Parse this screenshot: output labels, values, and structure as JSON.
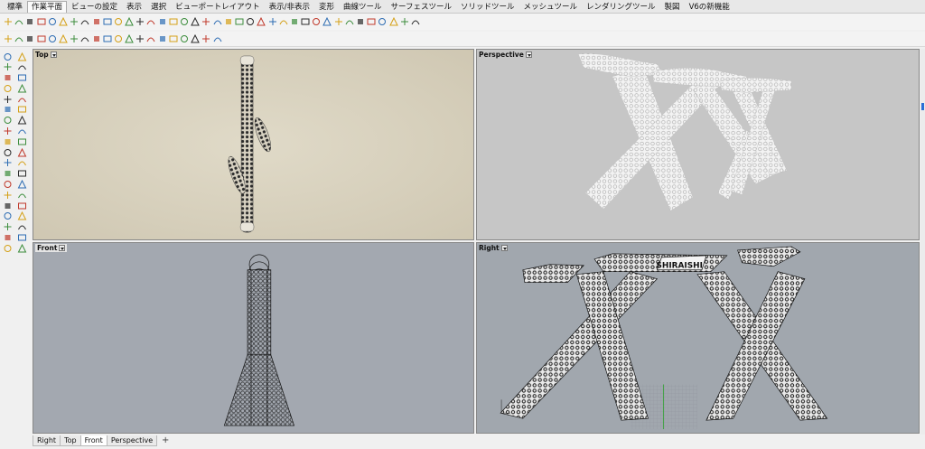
{
  "menu_tabs": [
    {
      "label": "標準",
      "active": false
    },
    {
      "label": "作業平面",
      "active": true
    },
    {
      "label": "ビューの設定",
      "active": false
    },
    {
      "label": "表示",
      "active": false
    },
    {
      "label": "選択",
      "active": false
    },
    {
      "label": "ビューポートレイアウト",
      "active": false
    },
    {
      "label": "表示/非表示",
      "active": false
    },
    {
      "label": "変形",
      "active": false
    },
    {
      "label": "曲線ツール",
      "active": false
    },
    {
      "label": "サーフェスツール",
      "active": false
    },
    {
      "label": "ソリッドツール",
      "active": false
    },
    {
      "label": "メッシュツール",
      "active": false
    },
    {
      "label": "レンダリングツール",
      "active": false
    },
    {
      "label": "製図",
      "active": false
    },
    {
      "label": "V6の新機能",
      "active": false
    }
  ],
  "toolbar_row1_icons": [
    "cplane-icon",
    "cplane-elevation-icon",
    "cplane-world-icon",
    "cplane-object-icon",
    "cplane-curve-icon",
    "cplane-surface-icon",
    "cplane-3pt-icon",
    "cplane-view-icon",
    "cplane-rotate-icon",
    "cplane-x-icon",
    "cplane-y-icon",
    "cplane-z-icon",
    "cplane-undo-icon",
    "cplane-redo-icon",
    "cplane-vertical-icon",
    "cplane-top-icon",
    "cplane-bottom-icon",
    "cplane-left-icon",
    "cplane-right-icon",
    "cplane-front-icon",
    "cplane-back-icon",
    "cplane-named-icon",
    "cplane-save-icon",
    "folder-icon",
    "pan-icon",
    "rotate-view-icon",
    "zoom-window-icon",
    "zoom-extents-icon",
    "zoom-selected-icon",
    "zoom-all-icon",
    "zoom-in-icon",
    "undo-view-icon",
    "redo-view-icon",
    "named-view-icon",
    "set-view-icon",
    "camera-icon",
    "light-icon",
    "render-icon"
  ],
  "toolbar_row2_icons": [
    "cancel-icon",
    "rotate-3d-icon",
    "box-icon",
    "display-mode-icon",
    "cut-icon",
    "point-icon",
    "triangle-icon",
    "line-icon",
    "sun-icon",
    "hatch-icon",
    "gumball-icon",
    "circle-icon",
    "target-icon",
    "layer-icon",
    "palette-icon",
    "paint-icon",
    "printer-icon",
    "material-icon",
    "options-icon",
    "help-icon"
  ],
  "palette_icons": [
    "select-arrow-icon",
    "point-dot-icon",
    "polyline-icon",
    "line-segment-icon",
    "curve-icon",
    "arc-icon",
    "circle-tool-icon",
    "ellipse-icon",
    "rectangle-icon",
    "polygon-icon",
    "freeform-icon",
    "text-icon",
    "fillet-icon",
    "offset-icon",
    "surface-icon",
    "extrude-icon",
    "sphere-icon",
    "cylinder-icon",
    "box-solid-icon",
    "torus-icon",
    "mesh-icon",
    "pipe-icon",
    "boolean-icon",
    "split-icon",
    "move-icon",
    "copy-icon",
    "rotate-icon",
    "scale-icon",
    "array-icon",
    "mirror-icon",
    "trim-icon",
    "join-icon",
    "explode-icon",
    "group-icon",
    "dimension-icon",
    "leader-icon",
    "check-icon",
    "analyze-icon"
  ],
  "viewports": {
    "top": {
      "label": "Top"
    },
    "perspective": {
      "label": "Perspective"
    },
    "front": {
      "label": "Front"
    },
    "right": {
      "label": "Right"
    }
  },
  "view_tabs": [
    {
      "label": "Right",
      "active": false
    },
    {
      "label": "Top",
      "active": false
    },
    {
      "label": "Front",
      "active": true
    },
    {
      "label": "Perspective",
      "active": false
    }
  ],
  "add_tab_label": "+",
  "engraved_text": "SHIRAISHI",
  "colors": {
    "top_bg": "#d6cfbb",
    "perspective_bg": "#c6c6c6",
    "front_bg": "#a3a8b0",
    "right_bg": "#a1a7ae",
    "model_light": "#f4f4f4",
    "wire_dark": "#111111"
  }
}
